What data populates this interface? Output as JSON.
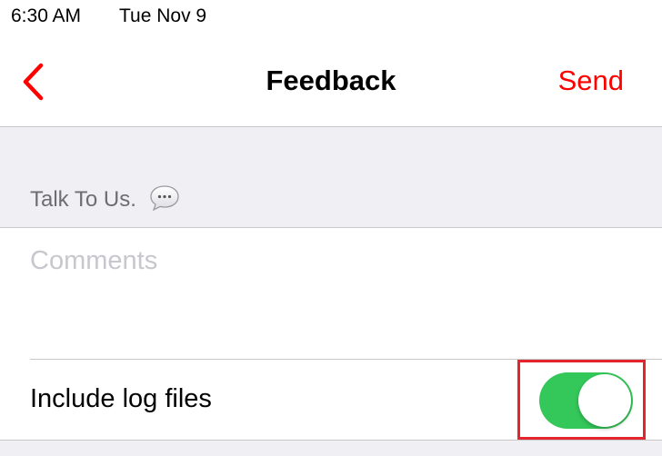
{
  "status_bar": {
    "time": "6:30 AM",
    "date": "Tue Nov 9"
  },
  "nav": {
    "title": "Feedback",
    "send_label": "Send",
    "back_icon": "chevron-left-icon",
    "accent_color": "#ff0000"
  },
  "section": {
    "header": "Talk To Us.",
    "header_icon": "speech-bubble-icon"
  },
  "comments": {
    "placeholder": "Comments",
    "value": ""
  },
  "log_files": {
    "label": "Include log files",
    "enabled": true,
    "toggle_color": "#34c759"
  }
}
